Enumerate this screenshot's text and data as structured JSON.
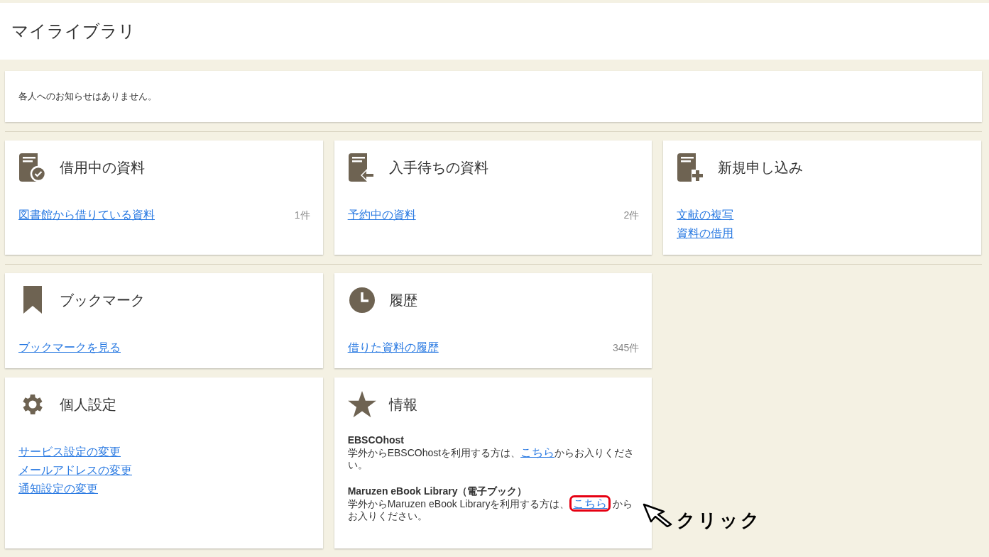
{
  "page_title": "マイライブラリ",
  "notice": "各人へのお知らせはありません。",
  "sections": [
    {
      "cards": [
        {
          "kind": "book-check",
          "title": "借用中の資料",
          "links": [
            {
              "label": "図書館から借りている資料",
              "count": "1件"
            }
          ]
        },
        {
          "kind": "book-arrow",
          "title": "入手待ちの資料",
          "links": [
            {
              "label": "予約中の資料",
              "count": "2件"
            }
          ]
        },
        {
          "kind": "book-plus",
          "title": "新規申し込み",
          "links": [
            {
              "label": "文献の複写"
            },
            {
              "label": "資料の借用"
            }
          ]
        }
      ]
    },
    {
      "cards": [
        {
          "kind": "bookmark",
          "title": "ブックマーク",
          "links": [
            {
              "label": "ブックマークを見る"
            }
          ]
        },
        {
          "kind": "clock",
          "title": "履歴",
          "links": [
            {
              "label": "借りた資料の履歴",
              "count": "345件"
            }
          ]
        }
      ]
    },
    {
      "cards": [
        {
          "kind": "gear",
          "title": "個人設定",
          "links": [
            {
              "label": "サービス設定の変更"
            },
            {
              "label": "メールアドレスの変更"
            },
            {
              "label": "通知設定の変更"
            }
          ]
        },
        {
          "kind": "star",
          "title": "情報",
          "info": [
            {
              "heading": "EBSCOhost",
              "before": "学外からEBSCOhostを利用する方は、",
              "link": "こちら",
              "after": "からお入りください。",
              "highlighted": false
            },
            {
              "heading": "Maruzen eBook Library（電子ブック）",
              "before": "学外からMaruzen eBook Libraryを利用する方は、",
              "link": "こちら",
              "after": "からお入りください。",
              "highlighted": true
            }
          ]
        }
      ],
      "callout": "クリック"
    }
  ]
}
